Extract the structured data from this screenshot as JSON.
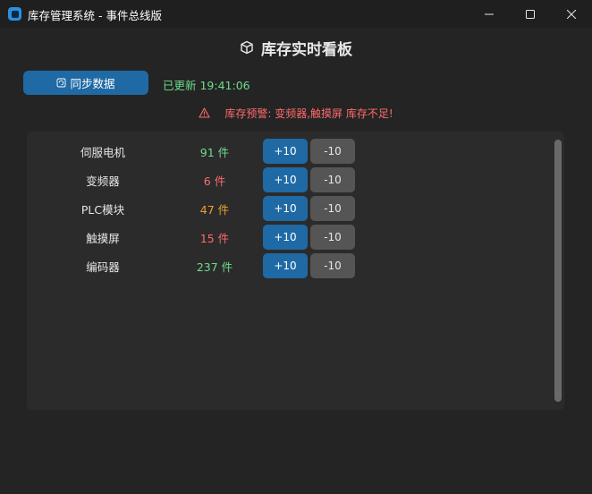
{
  "window": {
    "title": "库存管理系统 - 事件总线版",
    "icon": "app-icon",
    "controls": [
      "minimize-icon",
      "maximize-icon",
      "close-icon"
    ]
  },
  "header": {
    "icon": "cube-icon",
    "title": "库存实时看板"
  },
  "toolbar": {
    "sync_icon": "refresh-icon",
    "sync_label": "同步数据",
    "updated_text": "已更新 19:41:06"
  },
  "alert": {
    "icon": "warning-icon",
    "text": "库存预警: 变频器,触摸屏 库存不足!"
  },
  "inventory": [
    {
      "name": "伺服电机",
      "qty": "91 件",
      "qty_color": "#6fdc8c",
      "plus": "+10",
      "minus": "-10"
    },
    {
      "name": "变频器",
      "qty": "6 件",
      "qty_color": "#ff6b6b",
      "plus": "+10",
      "minus": "-10"
    },
    {
      "name": "PLC模块",
      "qty": "47 件",
      "qty_color": "#f0a030",
      "plus": "+10",
      "minus": "-10"
    },
    {
      "name": "触摸屏",
      "qty": "15 件",
      "qty_color": "#ff6b6b",
      "plus": "+10",
      "minus": "-10"
    },
    {
      "name": "编码器",
      "qty": "237 件",
      "qty_color": "#6fdc8c",
      "plus": "+10",
      "minus": "-10"
    }
  ],
  "colors": {
    "accent": "#1f6aa5",
    "ok": "#6fdc8c",
    "warn": "#f0a030",
    "danger": "#ff6b6b"
  }
}
